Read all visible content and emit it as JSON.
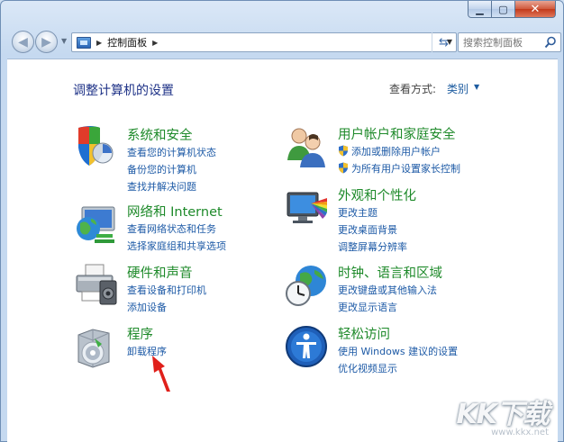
{
  "window": {
    "address": {
      "segment": "控制面板"
    },
    "search": {
      "placeholder": "搜索控制面板"
    }
  },
  "content": {
    "title": "调整计算机的设置",
    "view_by_label": "查看方式:",
    "view_by_value": "类别"
  },
  "categories": [
    {
      "title": "系统和安全",
      "links": [
        "查看您的计算机状态",
        "备份您的计算机",
        "查找并解决问题"
      ]
    },
    {
      "title": "网络和 Internet",
      "links": [
        "查看网络状态和任务",
        "选择家庭组和共享选项"
      ]
    },
    {
      "title": "硬件和声音",
      "links": [
        "查看设备和打印机",
        "添加设备"
      ]
    },
    {
      "title": "程序",
      "links": [
        "卸载程序"
      ]
    },
    {
      "title": "用户帐户和家庭安全",
      "links": [
        "添加或删除用户帐户",
        "为所有用户设置家长控制"
      ]
    },
    {
      "title": "外观和个性化",
      "links": [
        "更改主题",
        "更改桌面背景",
        "调整屏幕分辨率"
      ]
    },
    {
      "title": "时钟、语言和区域",
      "links": [
        "更改键盘或其他输入法",
        "更改显示语言"
      ]
    },
    {
      "title": "轻松访问",
      "links": [
        "使用 Windows 建议的设置",
        "优化视频显示"
      ]
    }
  ],
  "watermark": {
    "logo": "KK下载",
    "url": "www.kkx.net"
  },
  "icons": {
    "back": "back-arrow-icon",
    "forward": "forward-arrow-icon",
    "refresh": "refresh-icon",
    "search": "search-icon",
    "shield": "uac-shield-icon"
  },
  "colors": {
    "category_title": "#1e8a2a",
    "link": "#1d5aa6",
    "page_title": "#1e3287",
    "close_button": "#c23a1c"
  }
}
